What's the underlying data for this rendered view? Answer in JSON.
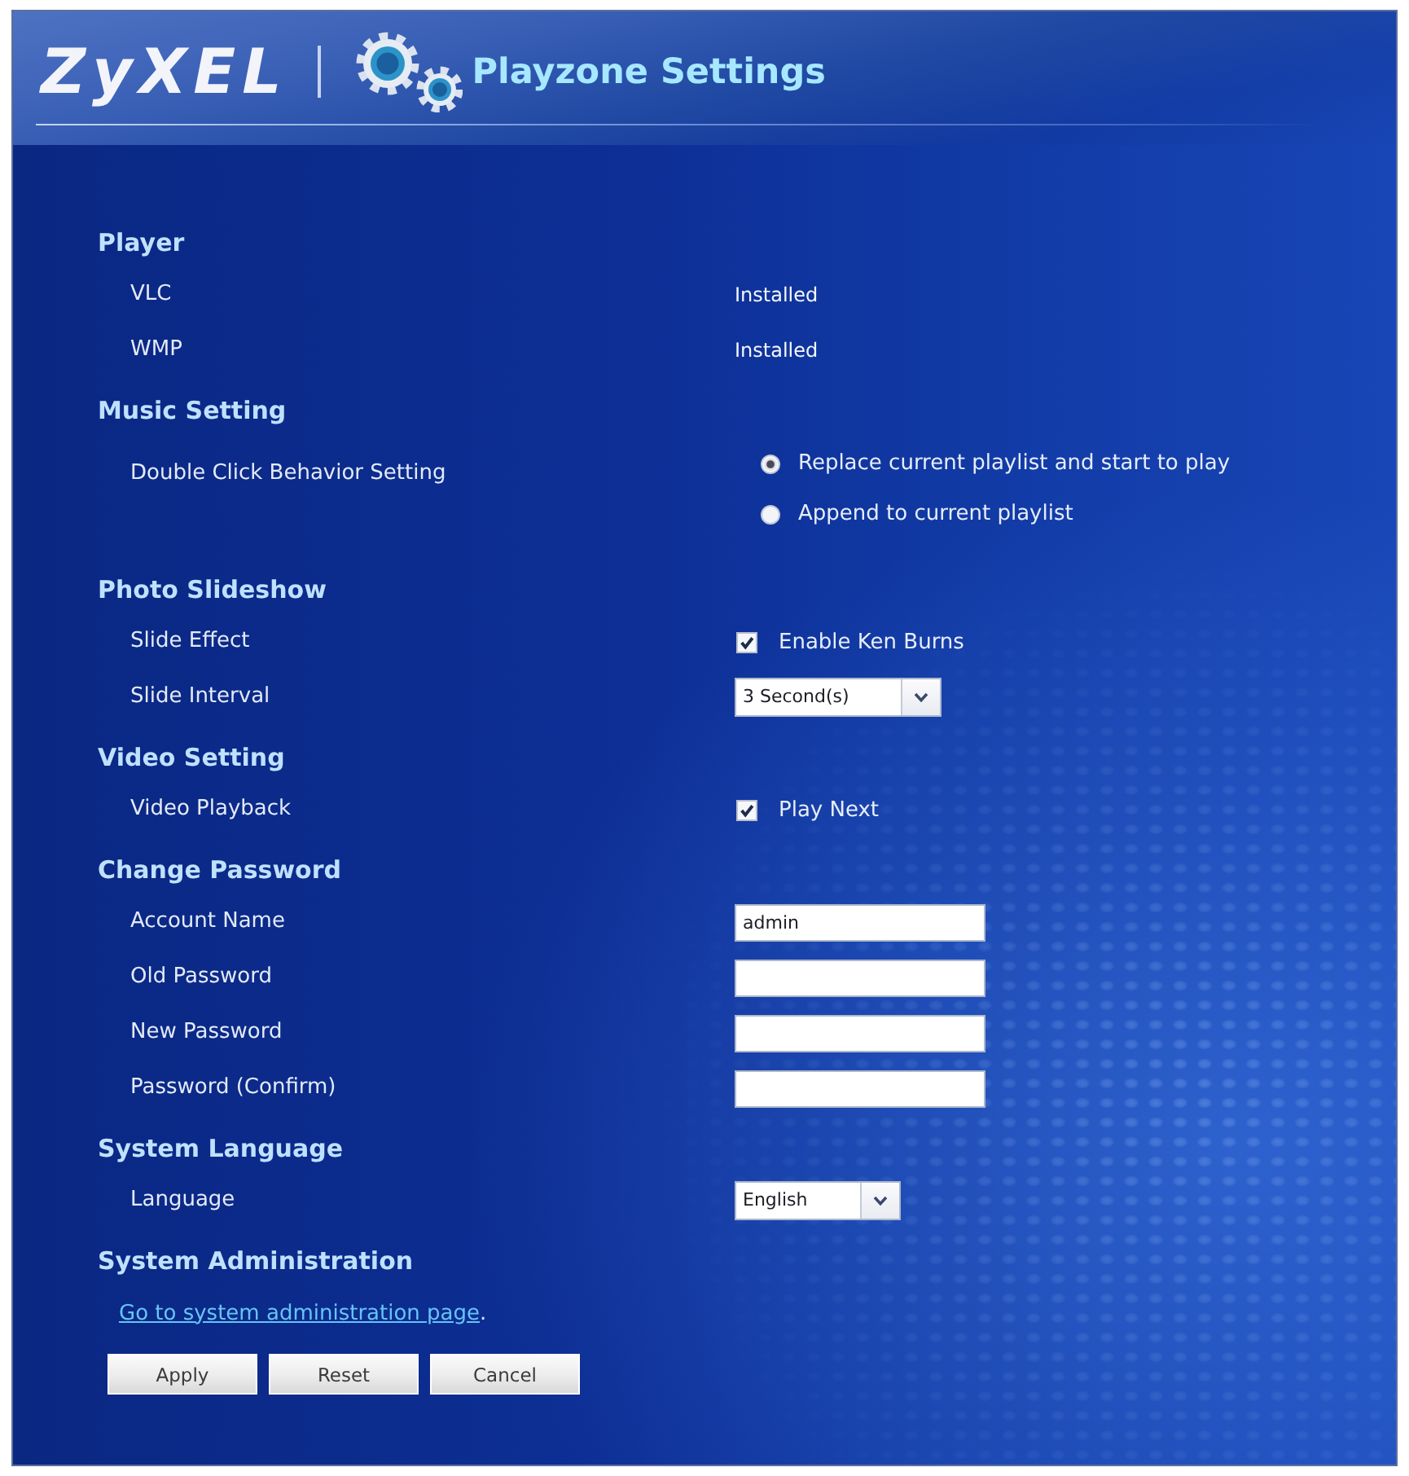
{
  "header": {
    "logo": "ZyXEL",
    "title": "Playzone Settings"
  },
  "sections": [
    {
      "title": "Player",
      "rows": [
        {
          "kind": "text",
          "label": "VLC",
          "value": "Installed"
        },
        {
          "kind": "text",
          "label": "WMP",
          "value": "Installed"
        }
      ]
    },
    {
      "title": "Music Setting",
      "rows": [
        {
          "kind": "radio",
          "label": "Double Click Behavior Setting",
          "options": [
            {
              "label": "Replace current playlist and start to play",
              "selected": true
            },
            {
              "label": "Append to current playlist",
              "selected": false
            }
          ]
        }
      ]
    },
    {
      "title": "Photo Slideshow",
      "rows": [
        {
          "kind": "checkbox",
          "label": "Slide Effect",
          "option": "Enable Ken Burns",
          "checked": true
        },
        {
          "kind": "select",
          "label": "Slide Interval",
          "value": "3 Second(s)"
        }
      ]
    },
    {
      "title": "Video Setting",
      "rows": [
        {
          "kind": "checkbox",
          "label": "Video Playback",
          "option": "Play Next",
          "checked": true
        }
      ]
    },
    {
      "title": "Change Password",
      "rows": [
        {
          "kind": "input",
          "label": "Account Name",
          "value": "admin"
        },
        {
          "kind": "input",
          "label": "Old Password"
        },
        {
          "kind": "input",
          "label": "New Password"
        },
        {
          "kind": "input",
          "label": "Password (Confirm)"
        }
      ]
    },
    {
      "title": "System Language",
      "rows": [
        {
          "kind": "select",
          "label": "Language",
          "value": "English"
        }
      ]
    },
    {
      "title": "System Administration",
      "rows": [
        {
          "kind": "link",
          "link": "Go to system administration page",
          "after": "."
        }
      ]
    }
  ],
  "buttons": [
    "Apply",
    "Reset",
    "Cancel"
  ]
}
